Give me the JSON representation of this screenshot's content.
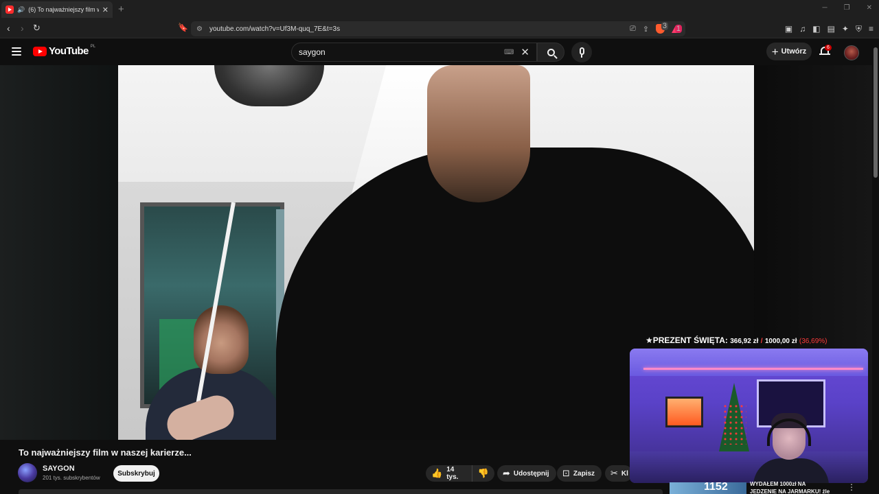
{
  "browser": {
    "tab_title": "(6) To najważniejszy film w na",
    "new_tab": "+",
    "url": "youtube.com/watch?v=Uf3M-quq_7E&t=3s",
    "brave_badge": "3",
    "ext_badge": "1"
  },
  "header": {
    "logo_text": "YouTube",
    "country_code": "PL",
    "search_value": "saygon",
    "create_label": "Utwórz",
    "notifications_count": "6"
  },
  "video": {
    "title": "To najważniejszy film w naszej karierze...",
    "channel_name": "SAYGON",
    "channel_subs": "201 tys. subskrybentów",
    "subscribe_label": "Subskrybuj",
    "likes": "14 tys.",
    "share_label": "Udostępnij",
    "save_label": "Zapisz",
    "clip_label": "Kl"
  },
  "overlay": {
    "goal_label": "★PREZENT ŚWIĘTA:",
    "goal_current": "366,92 zł",
    "goal_separator": "/",
    "goal_target": "1000,00 zł",
    "goal_percent": "(36,69%)",
    "goal_fraction": 0.3669
  },
  "recommendation": {
    "thumb_text": "1152",
    "title_line1": "WYDAŁEM 1000zł NA",
    "title_line2": "JEDZENIE NA JARMARKU! źle"
  },
  "colors": {
    "brand_red": "#ff0000",
    "background": "#0f0f0f",
    "goal_accent": "#ff3b3b"
  },
  "icons": [
    "back-icon",
    "forward-icon",
    "reload-icon",
    "bookmark-icon",
    "site-settings-icon",
    "cast-icon",
    "share-icon",
    "brave-shield-icon",
    "rewards-icon",
    "menu-icon",
    "search-icon",
    "mic-icon",
    "bell-icon",
    "like-icon",
    "dislike-icon",
    "share-arrow-icon",
    "save-icon",
    "scissors-icon"
  ]
}
